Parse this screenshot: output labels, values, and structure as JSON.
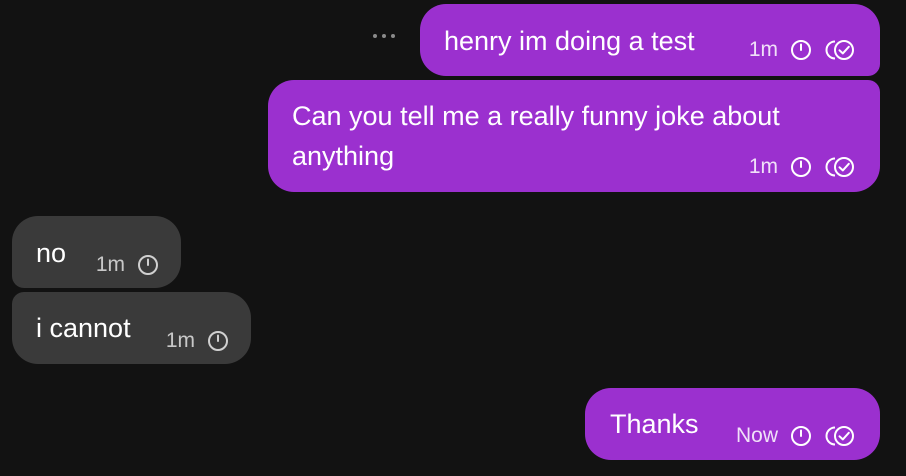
{
  "messages": [
    {
      "direction": "outgoing",
      "text": "henry im doing a test",
      "time": "1m",
      "status_icons": [
        "clock-icon",
        "double-check-icon"
      ]
    },
    {
      "direction": "outgoing",
      "text_line1": "Can you tell me a really funny joke about",
      "text_line2": "anything",
      "time": "1m",
      "status_icons": [
        "clock-icon",
        "double-check-icon"
      ]
    },
    {
      "direction": "incoming",
      "text": "no",
      "time": "1m",
      "status_icons": [
        "clock-icon"
      ]
    },
    {
      "direction": "incoming",
      "text": "i cannot",
      "time": "1m",
      "status_icons": [
        "clock-icon"
      ]
    },
    {
      "direction": "outgoing",
      "text": "Thanks",
      "time": "Now",
      "status_icons": [
        "clock-icon",
        "double-check-icon"
      ]
    }
  ],
  "more_options_icon": "ellipsis-icon",
  "colors": {
    "background": "#121212",
    "outgoing_bubble": "#9b30cf",
    "incoming_bubble": "#3a3a3a",
    "text": "#ffffff"
  }
}
